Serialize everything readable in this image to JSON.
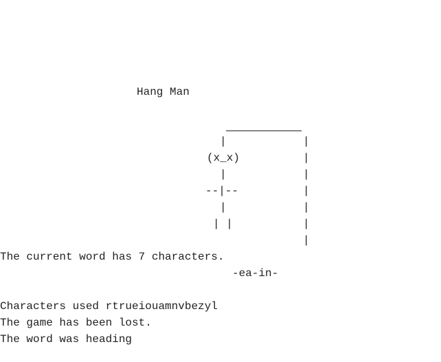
{
  "title": "Hang Man",
  "drawing": {
    "post_char": "|",
    "rope": "|",
    "head": "(x_x)",
    "neck": "|",
    "arms": "--|--",
    "body": "|",
    "legs": "| |"
  },
  "messages": {
    "word_length": "The current word has 7 characters.",
    "masked_word": "-ea-in-",
    "characters_used": "Characters used rtrueiouamnvbezyl",
    "game_status": "The game has been lost.",
    "answer": "The word was heading"
  }
}
